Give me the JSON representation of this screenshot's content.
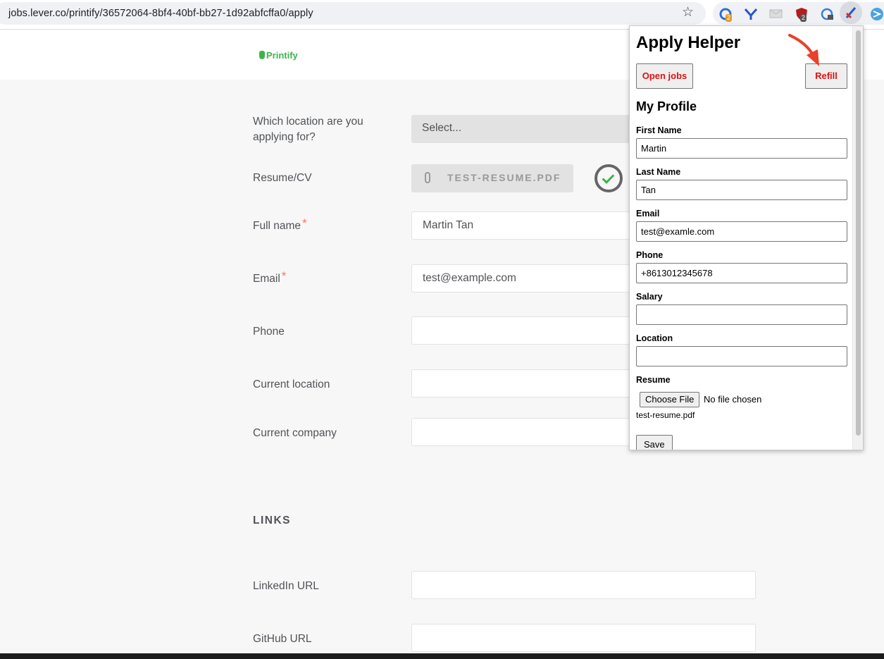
{
  "browser": {
    "url": "jobs.lever.co/printify/36572064-8bf4-40bf-bb27-1d92abfcffa0/apply",
    "extensions": [
      {
        "name": "grammarly-like-icon",
        "badge": "2"
      },
      {
        "name": "vpn-icon",
        "badge": ""
      },
      {
        "name": "mail-icon",
        "badge": ""
      },
      {
        "name": "shield-icon",
        "badge": "2"
      },
      {
        "name": "refresh-lock-icon",
        "badge": ""
      },
      {
        "name": "apply-helper-icon",
        "badge": ""
      },
      {
        "name": "arrow-ext-icon",
        "badge": ""
      }
    ]
  },
  "header": {
    "brand": "Printify"
  },
  "form": {
    "location_label": "Which location are you applying for?",
    "location_select": "Select...",
    "resume_label": "Resume/CV",
    "resume_file": "TEST-RESUME.PDF",
    "fullname_label": "Full name",
    "fullname_value": "Martin Tan",
    "email_label": "Email",
    "email_value": "test@example.com",
    "phone_label": "Phone",
    "current_location_label": "Current location",
    "current_company_label": "Current company",
    "links_title": "LINKS",
    "linkedin_label": "LinkedIn URL",
    "github_label": "GitHub URL",
    "required_mark": "*"
  },
  "popup": {
    "title": "Apply Helper",
    "open_jobs": "Open jobs",
    "refill": "Refill",
    "section": "My Profile",
    "first_name_label": "First Name",
    "first_name": "Martin",
    "last_name_label": "Last Name",
    "last_name": "Tan",
    "email_label": "Email",
    "email": "test@examle.com",
    "phone_label": "Phone",
    "phone": "+8613012345678",
    "salary_label": "Salary",
    "salary": "",
    "location_label": "Location",
    "location": "",
    "resume_label": "Resume",
    "choose_file": "Choose File",
    "no_file": "No file chosen",
    "resume_file": "test-resume.pdf",
    "save": "Save"
  },
  "colors": {
    "accent_green": "#3bb54a",
    "required_orange": "#ff794f",
    "popup_button_red": "#e01010",
    "annotation_arrow": "#e8412c"
  }
}
